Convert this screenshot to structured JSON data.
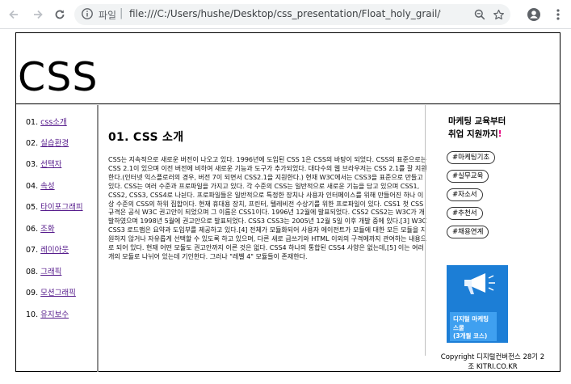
{
  "browser": {
    "scheme": "파일",
    "url": "file:///C:/Users/hushe/Desktop/css_presentation/Float_holy_grail/float_...",
    "colors": {
      "chrome_bg": "#ffffff",
      "omnibox_bg": "#f1f3f4",
      "icon": "#5f6368"
    }
  },
  "header": {
    "title": "CSS"
  },
  "nav": {
    "items": [
      {
        "num": "01.",
        "label": "css소개"
      },
      {
        "num": "02.",
        "label": "실습환경"
      },
      {
        "num": "03.",
        "label": "선택자"
      },
      {
        "num": "04.",
        "label": "속성"
      },
      {
        "num": "05.",
        "label": "타이포그래피"
      },
      {
        "num": "06.",
        "label": "조화"
      },
      {
        "num": "07.",
        "label": "레이아웃"
      },
      {
        "num": "08.",
        "label": "그래픽"
      },
      {
        "num": "09.",
        "label": "모션그래픽"
      },
      {
        "num": "10.",
        "label": "유지보수"
      }
    ]
  },
  "main": {
    "heading": "01. CSS 소개",
    "body": "CSS는 지속적으로 새로운 버전이 나오고 있다. 1996년에 도입된 CSS 1은 CSS의 바탕이 되었다. CSS의 표준으로는 CSS 2.1이 있으며 이전 버전에 비하여 새로운 기능과 도구가 추가되었다. 대다수의 웹 브라우저는 CSS 2.1를 잘 지원한다.(인터넷 익스플로러의 경우, 버전 7이 되면서 CSS2.1을 지원한다.) 현재 W3C에서는 CSS3을 표준으로 만들고 있다. CSS는 여러 수준과 프로파일을 가지고 있다. 각 수준의 CSS는 일반적으로 새로운 기능을 담고 있으며 CSS1, CSS2, CSS3, CSS4로 나뉜다. 프로파일들은 일반적으로 특정한 장치나 사용자 인터페이스를 위해 만들어진 하나 이상 수준의 CSS의 하위 집합이다. 현재 휴대용 장치, 프린터, 텔레비전 수상기를 위한 프로파일이 있다. CSS1 첫 CSS 규격은 공식 W3C 권고안이 되었으며 그 이름은 CSS1이다. 1996년 12월에 발표되었다. CSS2 CSS2는 W3C가 개발하였으며 1998년 5월에 권고안으로 발표되었다. CSS3 CSS3는 2005년 12월 5일 이후 개발 중에 있다.[3] W3C CSS3 로드맵은 요약과 도입부를 제공하고 있다.[4] 전체가 모듈화되어 사용자 에이전트가 모듈에 대한 모든 모듈을 지원하지 않거나 자유롭게 선택할 수 있도록 하고 있으며, 다른 새로 급쓰기와 HTML 이외의 구격에까지 관여하는 내용으로 되어 있다. 현재 어떤 모듈도 권고안까지 이른 것은 없다. CSS4 하나의 통합된 CSS4 사양은 없는데,[5] 이는 여러 개의 모듈로 나뉘어 있는데 기인한다. 그러나 \"레벨 4\" 모듈들이 존재한다."
  },
  "aside": {
    "ad_title_line1": "마케팅 교육부터",
    "ad_title_line2": "취업 지원까지",
    "ad_title_mark": "!",
    "tags": [
      "#마케팅기초",
      "#실무교육",
      "#자소서",
      "#추천서",
      "#채용연계"
    ],
    "ad_image_text_1": "디지털 마케팅",
    "ad_image_text_2": "스쿨",
    "ad_image_text_3": "(3개월 코스)",
    "copyright_line1": "Copyright 디지털컨버전스 28기 2",
    "copyright_line2": "조 KITRI.CO.KR"
  }
}
